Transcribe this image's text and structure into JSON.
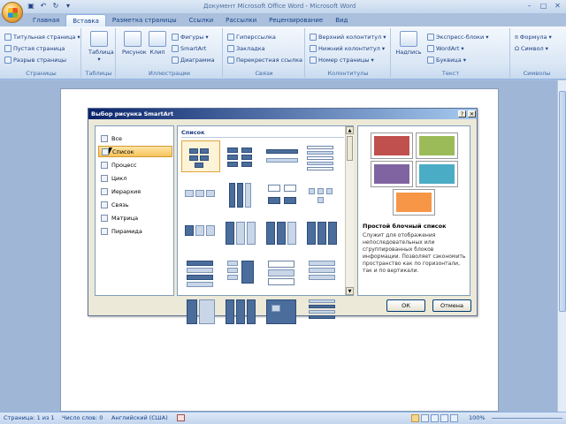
{
  "window": {
    "title": "Документ Microsoft Office Word - Microsoft Word"
  },
  "tabs": [
    "Главная",
    "Вставка",
    "Разметка страницы",
    "Ссылки",
    "Рассылки",
    "Рецензирование",
    "Вид"
  ],
  "ribbon": {
    "pages": {
      "label": "Страницы",
      "items": [
        "Титульная страница",
        "Пустая страница",
        "Разрыв страницы"
      ]
    },
    "tables": {
      "label": "Таблицы",
      "button": "Таблица"
    },
    "illustrations": {
      "label": "Иллюстрации",
      "picture": "Рисунок",
      "clip": "Клип",
      "items": [
        "Фигуры",
        "SmartArt",
        "Диаграмма"
      ]
    },
    "links": {
      "label": "Связи",
      "items": [
        "Гиперссылка",
        "Закладка",
        "Перекрестная ссылка"
      ]
    },
    "headers": {
      "label": "Колонтитулы",
      "items": [
        "Верхний колонтитул",
        "Нижний колонтитул",
        "Номер страницы"
      ]
    },
    "text": {
      "label": "Текст",
      "textbox": "Надпись",
      "items": [
        "Экспресс-блоки",
        "WordArt",
        "Буквица"
      ]
    },
    "symbols": {
      "label": "Символы",
      "items": [
        "Формула",
        "Символ"
      ]
    }
  },
  "dialog": {
    "title": "Выбор рисунка SmartArt",
    "help": "?",
    "close": "✕",
    "categories": [
      "Все",
      "Список",
      "Процесс",
      "Цикл",
      "Иерархия",
      "Связь",
      "Матрица",
      "Пирамида"
    ],
    "selected_category": "Список",
    "gallery_heading": "Список",
    "preview_title": "Простой блочный список",
    "preview_description": "Служит для отображения непоследовательных или сгруппированных блоков информации. Позволяет сэкономить пространство как по горизонтали, так и по вертикали.",
    "ok": "ОК",
    "cancel": "Отмена",
    "preview_colors": [
      "#c0504d",
      "#9bbb59",
      "#8064a2",
      "#4bacc6",
      "#f79646"
    ]
  },
  "status": {
    "page": "Страница: 1 из 1",
    "words": "Число слов: 0",
    "language": "Английский (США)",
    "zoom": "100%"
  }
}
